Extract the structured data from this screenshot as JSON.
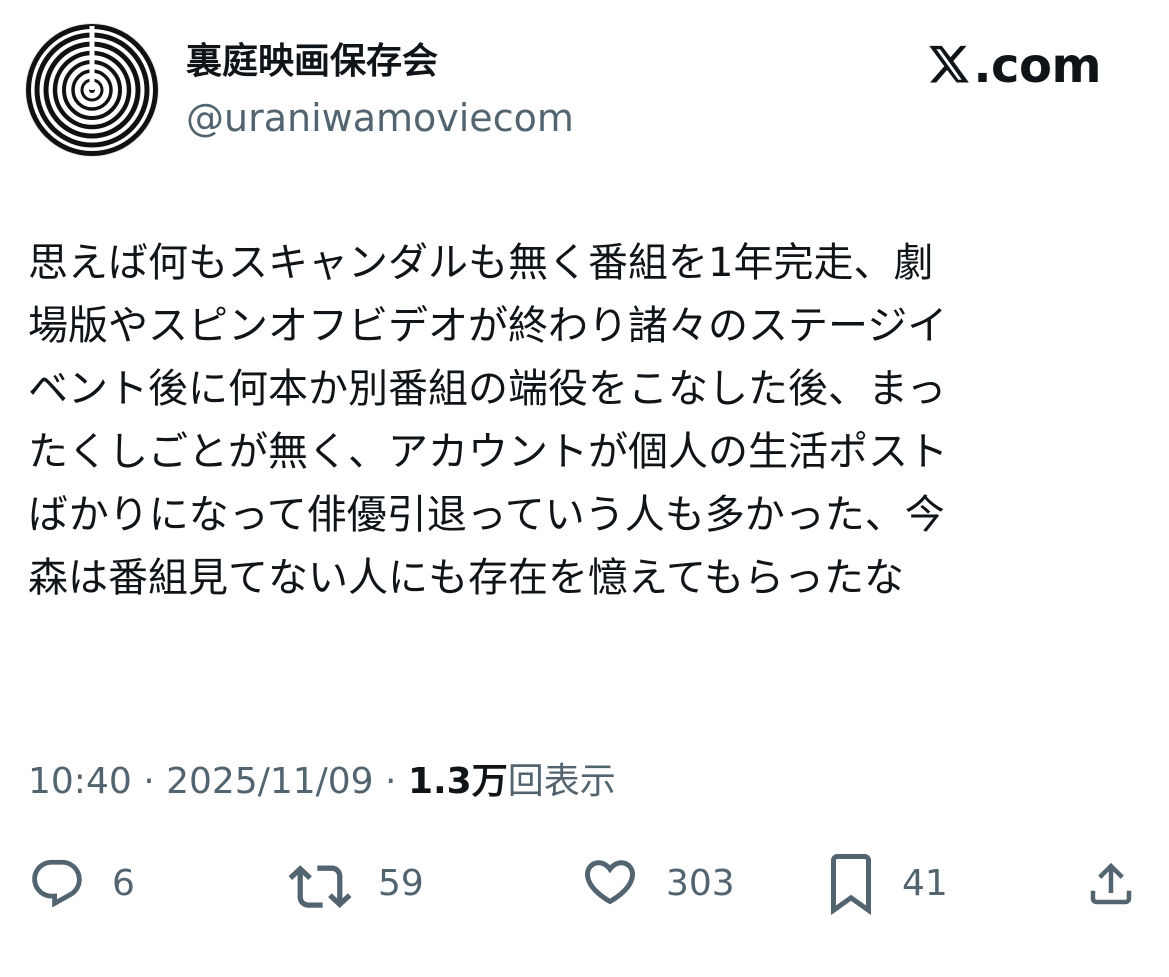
{
  "author": {
    "display_name": "裏庭映画保存会",
    "handle": "@uraniwamoviecom",
    "avatar_icon": "spiral-avatar-icon"
  },
  "site": {
    "logo_icon": "x-logo-icon",
    "label": ".com"
  },
  "tweet": {
    "text_lines": [
      "思えば何もスキャンダルも無く番組を1年完走、劇",
      "場版やスピンオフビデオが終わり諸々のステージイ",
      "ベント後に何本か別番組の端役をこなした後、まっ",
      "たくしごとが無く、アカウントが個人の生活ポスト",
      "ばかりになって俳優引退っていう人も多かった、今",
      "森は番組見てない人にも存在を憶えてもらったな"
    ]
  },
  "meta": {
    "time": "10:40",
    "separator": " · ",
    "date": "2025/11/09",
    "views_count": "1.3万",
    "views_label": "回表示"
  },
  "actions": {
    "replies": {
      "icon": "reply-icon",
      "count": "6"
    },
    "reposts": {
      "icon": "repost-icon",
      "count": "59"
    },
    "likes": {
      "icon": "heart-icon",
      "count": "303"
    },
    "bookmarks": {
      "icon": "bookmark-icon",
      "count": "41"
    },
    "share": {
      "icon": "share-icon"
    }
  },
  "colors": {
    "text_primary": "#0f1419",
    "text_secondary": "#536471",
    "background": "#ffffff"
  }
}
